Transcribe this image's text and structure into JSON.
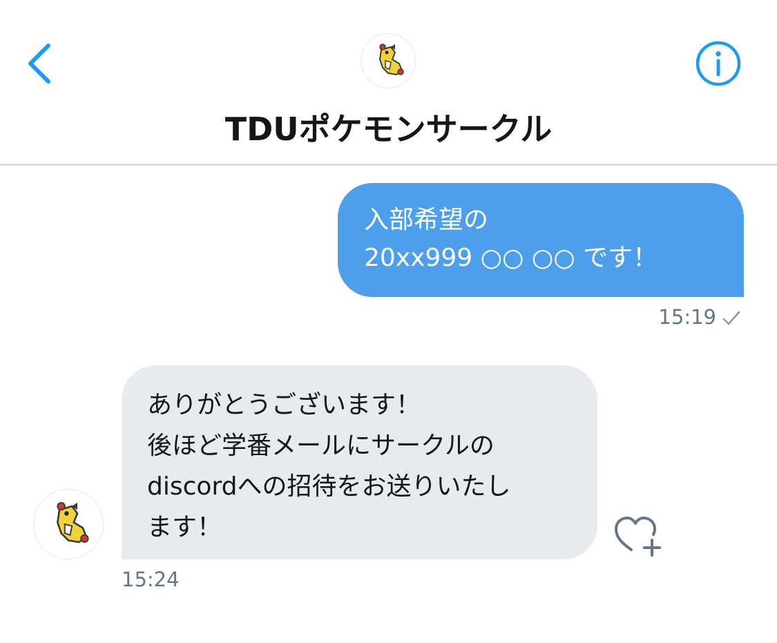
{
  "header": {
    "title": "TDUポケモンサークル",
    "back_icon": "chevron-left-icon",
    "info_icon": "info-icon",
    "avatar_icon": "pokemon-avatar-icon"
  },
  "messages": [
    {
      "direction": "outgoing",
      "text": "入部希望の\n20xx999 ○○ ○○ です！",
      "time": "15:19",
      "status_icon": "check-icon"
    },
    {
      "direction": "incoming",
      "text": "ありがとうございます！\n後ほど学番メールにサークルの\ndiscordへの招待をお送りいたし\nます！",
      "time": "15:24",
      "reaction_icon": "heart-plus-icon"
    }
  ],
  "colors": {
    "accent": "#1d9bf0",
    "outgoing_bubble": "#4d9fec",
    "incoming_bubble": "#e6ebef",
    "timestamp": "#657786"
  }
}
